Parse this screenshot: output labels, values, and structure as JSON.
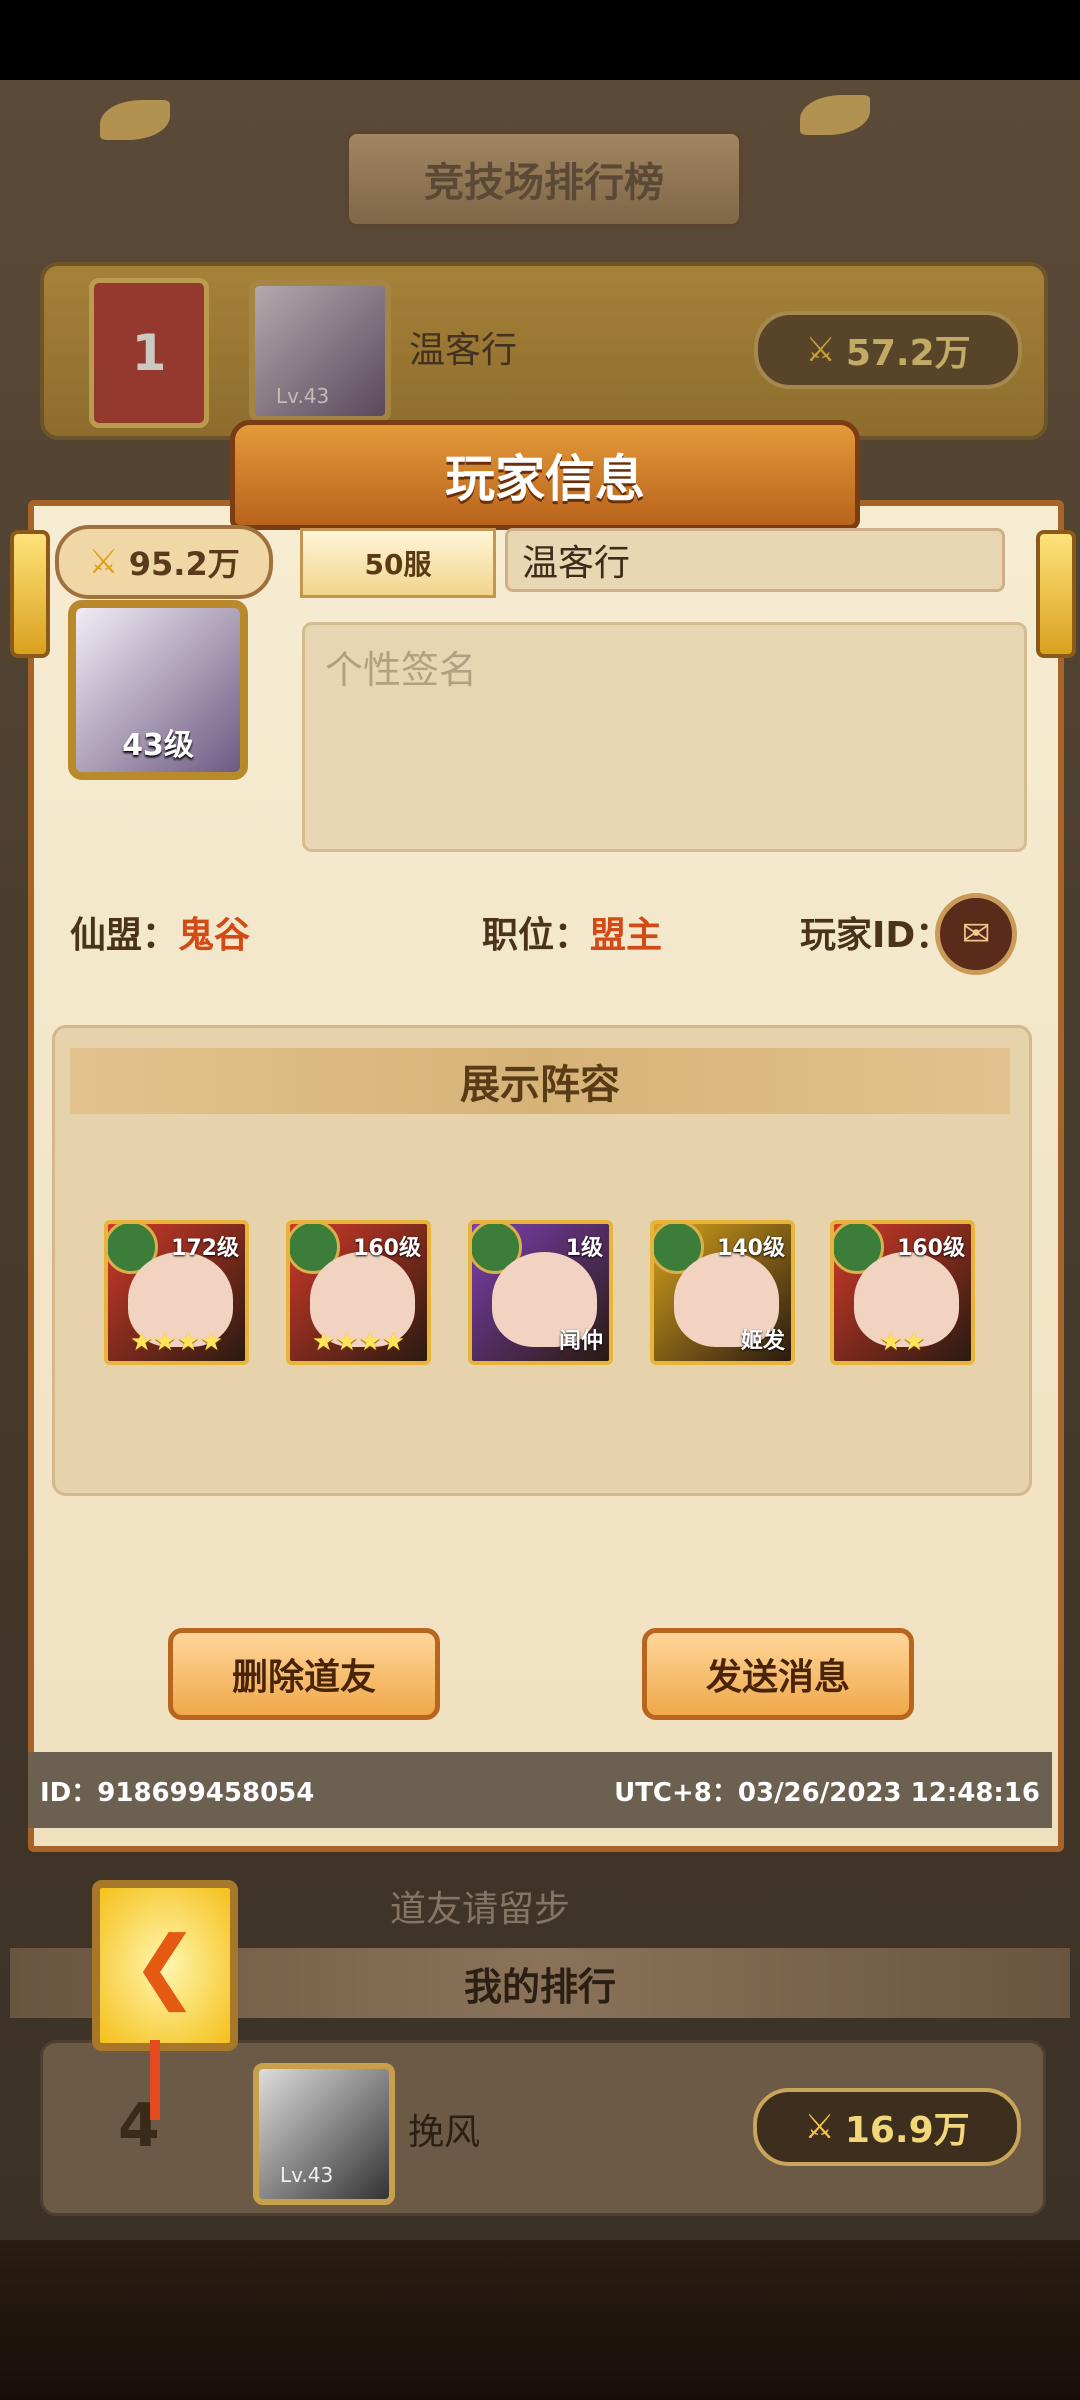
{
  "arena": {
    "title": "竞技场排行榜",
    "rank1": {
      "rank": "1",
      "avatar_level": "Lv.43",
      "name": "温客行",
      "power": "57.2万"
    },
    "rank_partial": {
      "name": "道友请留步"
    },
    "my_rank_title": "我的排行",
    "my_row": {
      "rank": "4",
      "avatar_level": "Lv.43",
      "name": "挽风",
      "power": "16.9万"
    }
  },
  "player_info": {
    "header": "玩家信息",
    "power": "95.2万",
    "server": "50服",
    "name": "温客行",
    "avatar_level": "43级",
    "signature_placeholder": "个性签名",
    "guild_label": "仙盟：",
    "guild_value": "鬼谷",
    "position_label": "职位：",
    "position_value": "盟主",
    "player_id_label": "玩家ID：",
    "lineup_title": "展示阵容",
    "heroes": [
      {
        "level": "172级",
        "stars": "★★★★",
        "name": "",
        "frame_color": "#d13a2a"
      },
      {
        "level": "160级",
        "stars": "★★★★",
        "name": "",
        "frame_color": "#d13a2a"
      },
      {
        "level": "1级",
        "stars": "",
        "name": "闻仲",
        "frame_color": "#7a3fb0"
      },
      {
        "level": "140级",
        "stars": "",
        "name": "姬发",
        "frame_color": "#d6a21c"
      },
      {
        "level": "160级",
        "stars": "★★",
        "name": "",
        "frame_color": "#d13a2a"
      }
    ],
    "delete_button": "删除道友",
    "message_button": "发送消息",
    "id_text": "ID：918699458054",
    "time_text": "UTC+8：03/26/2023 12:48:16"
  },
  "icons": {
    "sword": "crossed-swords-icon",
    "id_icon": "speech-scroll-icon",
    "back": "back-arrow-icon"
  },
  "colors": {
    "accent_orange": "#d24a16",
    "modal_bg": "#f6ecd2",
    "gold": "#f5c444"
  }
}
